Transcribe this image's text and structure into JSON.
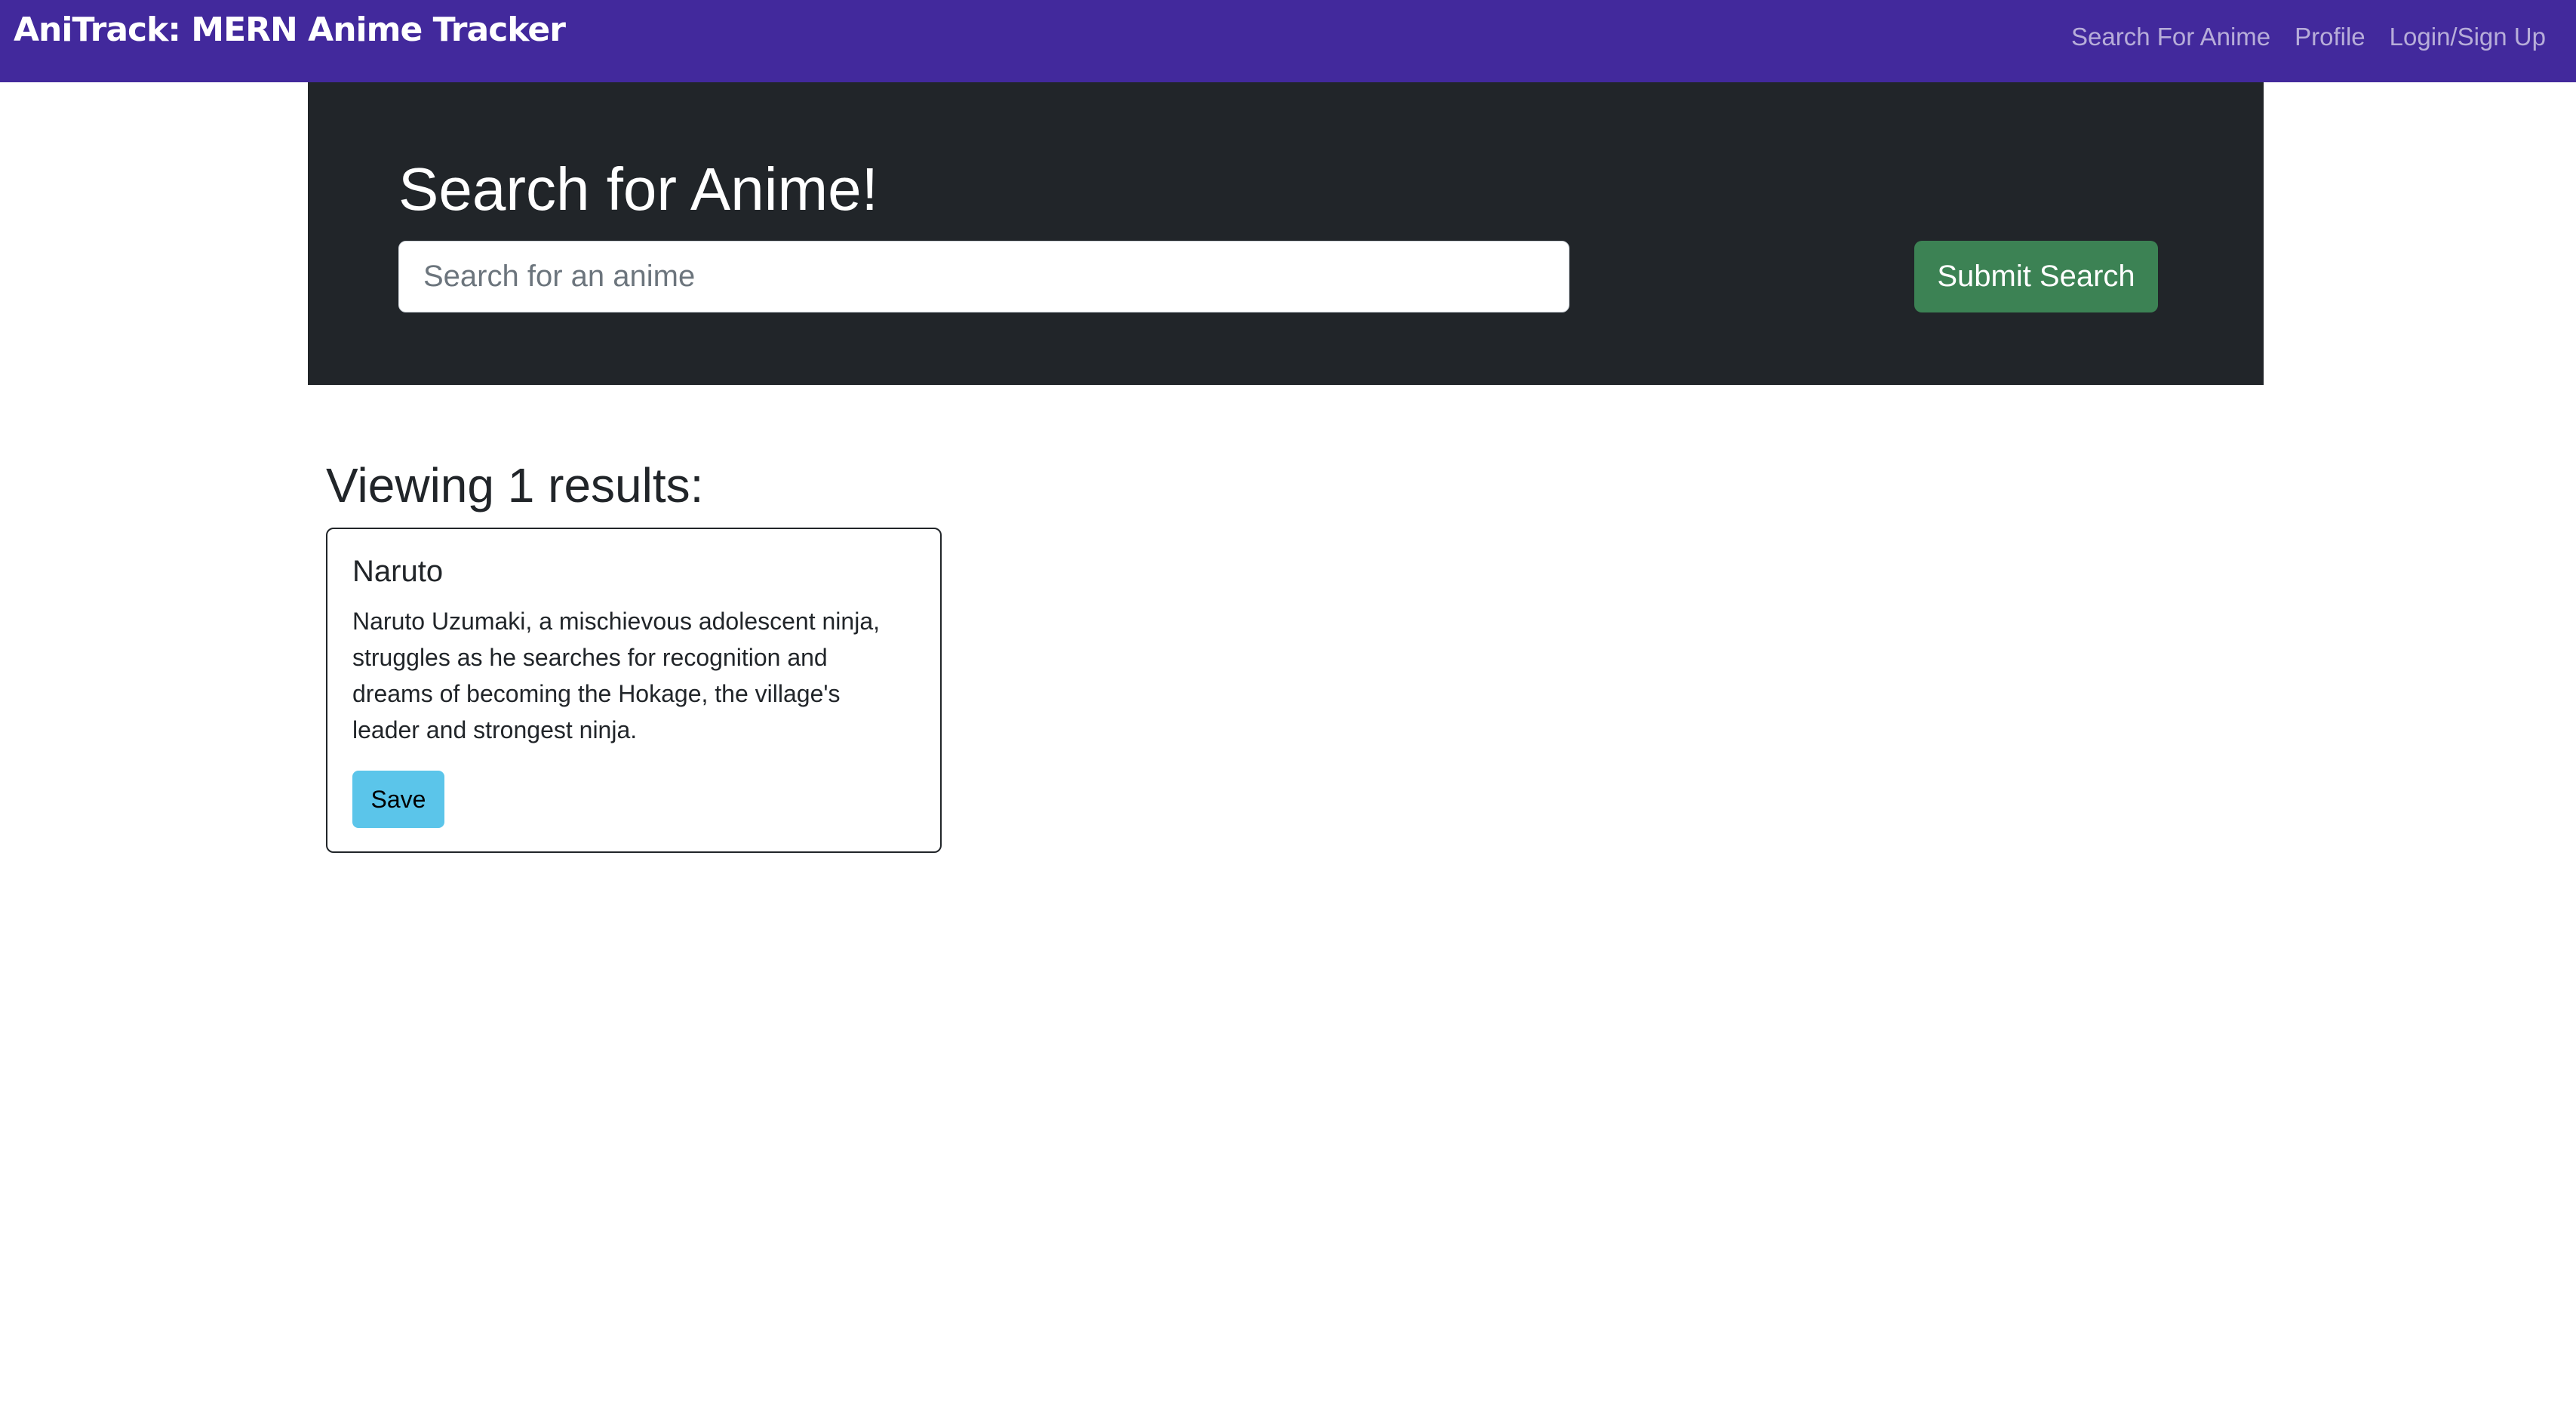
{
  "navbar": {
    "brand": "AniTrack: MERN Anime Tracker",
    "links": [
      {
        "label": "Search For Anime"
      },
      {
        "label": "Profile"
      },
      {
        "label": "Login/Sign Up"
      }
    ]
  },
  "hero": {
    "title": "Search for Anime!",
    "search_placeholder": "Search for an anime",
    "search_value": "",
    "submit_label": "Submit Search"
  },
  "results": {
    "heading": "Viewing 1 results:",
    "cards": [
      {
        "title": "Naruto",
        "description": "Naruto Uzumaki, a mischievous adolescent ninja, struggles as he searches for recognition and dreams of becoming the Hokage, the village's leader and strongest ninja.",
        "save_label": "Save"
      }
    ]
  },
  "colors": {
    "navbar_bg": "#42299c",
    "hero_bg": "#212529",
    "submit_button": "#3c8254",
    "save_button": "#5bc5ea"
  }
}
